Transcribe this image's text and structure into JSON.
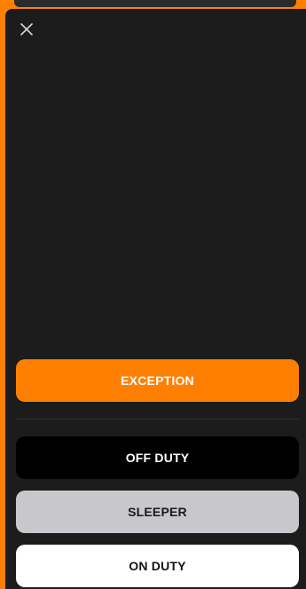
{
  "colors": {
    "accent": "#ff8000",
    "sheet_background": "#1c1c1c",
    "off_duty_background": "#000000",
    "sleeper_background": "#c7c7cc",
    "on_duty_background": "#ffffff"
  },
  "header": {
    "close_icon": "close-icon"
  },
  "status_buttons": {
    "exception_label": "EXCEPTION",
    "off_duty_label": "OFF DUTY",
    "sleeper_label": "SLEEPER",
    "on_duty_label": "ON DUTY"
  }
}
